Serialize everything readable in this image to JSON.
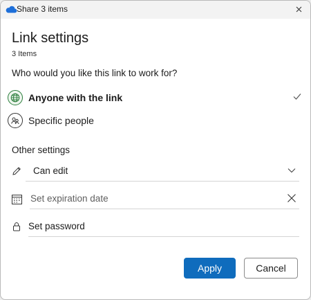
{
  "window": {
    "title": "Share 3 items",
    "close_label": "Close"
  },
  "header": {
    "title": "Link settings",
    "subtitle": "3 Items"
  },
  "audience": {
    "question": "Who would you like this link to work for?",
    "options": [
      {
        "label": "Anyone with the link",
        "icon": "globe-icon",
        "selected": true
      },
      {
        "label": "Specific people",
        "icon": "people-icon",
        "selected": false
      }
    ]
  },
  "other_settings": {
    "label": "Other settings",
    "permission": {
      "value": "Can edit",
      "icon": "pencil-icon"
    },
    "expiration": {
      "placeholder": "Set expiration date",
      "icon": "calendar-icon"
    },
    "password": {
      "placeholder": "Set password",
      "icon": "lock-icon"
    }
  },
  "actions": {
    "apply_label": "Apply",
    "cancel_label": "Cancel"
  },
  "colors": {
    "accent": "#0f6cbd",
    "selected_icon": "#2a7d3b",
    "cloud": "#1e6fd9"
  }
}
